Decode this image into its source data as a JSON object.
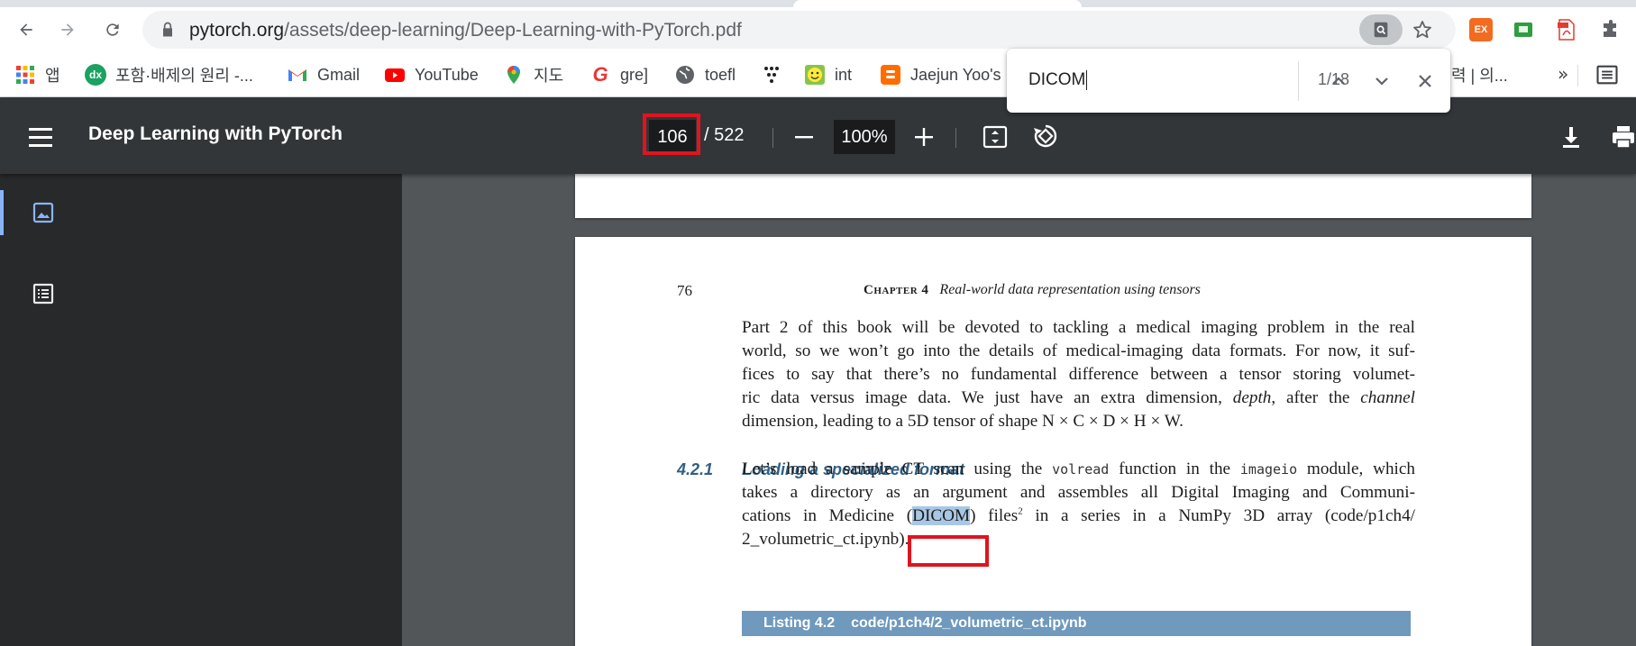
{
  "browser": {
    "url_host": "pytorch.org",
    "url_path": "/assets/deep-learning/Deep-Learning-with-PyTorch.pdf",
    "extensions": [
      {
        "label": "EX",
        "color": "#f26b21",
        "icon": "ex-extension-icon"
      },
      {
        "label": "",
        "color": "#2e9e3f",
        "icon": "green-extension-icon"
      },
      {
        "label": "PDF",
        "color": "#e33c2e",
        "icon": "pdf-extension-icon"
      },
      {
        "label": "",
        "color": "#5f6368",
        "icon": "puzzle-icon"
      }
    ]
  },
  "bookmarks": {
    "items": [
      {
        "label": "앱",
        "icon": "apps-grid-icon"
      },
      {
        "label": "포함·배제의 원리 -...",
        "icon": "bookmark-green-icon"
      },
      {
        "label": "Gmail",
        "icon": "gmail-icon"
      },
      {
        "label": "YouTube",
        "icon": "youtube-icon"
      },
      {
        "label": "지도",
        "icon": "maps-pin-icon"
      },
      {
        "label": "gre]",
        "icon": "gre-icon"
      },
      {
        "label": "toefl",
        "icon": "globe-icon"
      },
      {
        "label": "",
        "icon": "dots-icon"
      },
      {
        "label": "int",
        "icon": "smiley-icon"
      },
      {
        "label": "Jaejun Yoo's",
        "icon": "blogger-icon"
      }
    ],
    "hidden_tail": "력 | 의...",
    "overflow": "»"
  },
  "viewer": {
    "title": "Deep Learning with PyTorch",
    "current_page": "106",
    "total_pages": "/ 522",
    "zoom": "100%"
  },
  "find": {
    "query": "DICOM",
    "count": "1/18"
  },
  "page": {
    "number": "76",
    "chapter": "Chapter 4",
    "chapter_title": "Real-world data representation using tensors",
    "para1": [
      "Part 2 of this book will be devoted to tackling a medical imaging problem in the real",
      "world, so we won’t go into the details of medical-imaging data formats. For now, it suf-",
      "fices to say that there’s no fundamental difference between a tensor storing volumet-",
      "ric data versus image data. We just have an extra dimension, ",
      "depth",
      ", after the ",
      "channel",
      "dimension, leading to a 5D tensor of shape N × C × D × H × W."
    ],
    "section_number": "4.2.1",
    "section_title": "Loading a specialized format",
    "para2": [
      "Let’s load a sample CT scan using the ",
      "volread",
      " function in the ",
      "imageio",
      " module, which",
      "takes a directory as an argument and assembles all Digital Imaging and Communi-",
      "cations in Medicine (",
      "DICOM",
      ") files",
      "2",
      " in a series in a NumPy 3D array (code/p1ch4/",
      "2_volumetric_ct.ipynb)."
    ],
    "listing_label": "Listing 4.2",
    "listing_path": "code/p1ch4/2_volumetric_ct.ipynb"
  },
  "colors": {
    "toolbar_dark": "#323639",
    "sidebar": "#28292a",
    "canvas": "#525659",
    "highlight_outline": "#e0141e",
    "section_blue": "#2f5f86",
    "listing_blue": "#6f99bd",
    "search_hit": "#a8c7e4"
  }
}
